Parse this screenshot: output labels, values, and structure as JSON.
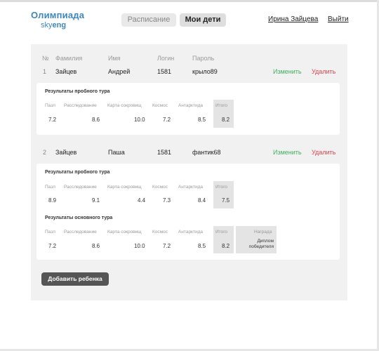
{
  "logo": {
    "title": "Олимпиада",
    "sub_a": "sky",
    "sub_b": "eng"
  },
  "nav": {
    "schedule": "Расписание",
    "my_children": "Мои дети"
  },
  "user": {
    "name": "Ирина Зайцева",
    "logout": "Выйти"
  },
  "children_table": {
    "headers": {
      "num": "№",
      "last_name": "Фамилия",
      "first_name": "Имя",
      "login": "Логин",
      "password": "Пароль"
    },
    "rows": [
      {
        "num": "1",
        "last_name": "Зайцев",
        "first_name": "Андрей",
        "login": "1581",
        "password": "крыло89",
        "edit": "Изменить",
        "delete": "Удалить"
      },
      {
        "num": "2",
        "last_name": "Зайцев",
        "first_name": "Паша",
        "login": "1581",
        "password": "фантик68",
        "edit": "Изменить",
        "delete": "Удалить"
      }
    ]
  },
  "results_headers": {
    "puzzle": "Пазл",
    "research": "Расследование",
    "treasure_map": "Карта сокровищ",
    "space": "Космос",
    "antarctica": "Антарктида",
    "total": "Итого",
    "award": "Награда"
  },
  "child1": {
    "trial_title": "Результаты пробного тура",
    "trial": {
      "puzzle": "7.2",
      "research": "8.6",
      "treasure_map": "10.0",
      "space": "7.2",
      "antarctica": "8.5",
      "total": "8.2"
    }
  },
  "child2": {
    "trial_title": "Результаты пробного тура",
    "trial": {
      "puzzle": "8.9",
      "research": "9.1",
      "treasure_map": "4.4",
      "space": "7.3",
      "antarctica": "8.4",
      "total": "7.5"
    },
    "main_title": "Результаты основного тура",
    "main": {
      "puzzle": "7.2",
      "research": "8.6",
      "treasure_map": "10.0",
      "space": "7.2",
      "antarctica": "8.5",
      "total": "8.2",
      "award_line1": "Диплом",
      "award_line2": "победителя"
    }
  },
  "add_child_button": "Добавить ребенка"
}
